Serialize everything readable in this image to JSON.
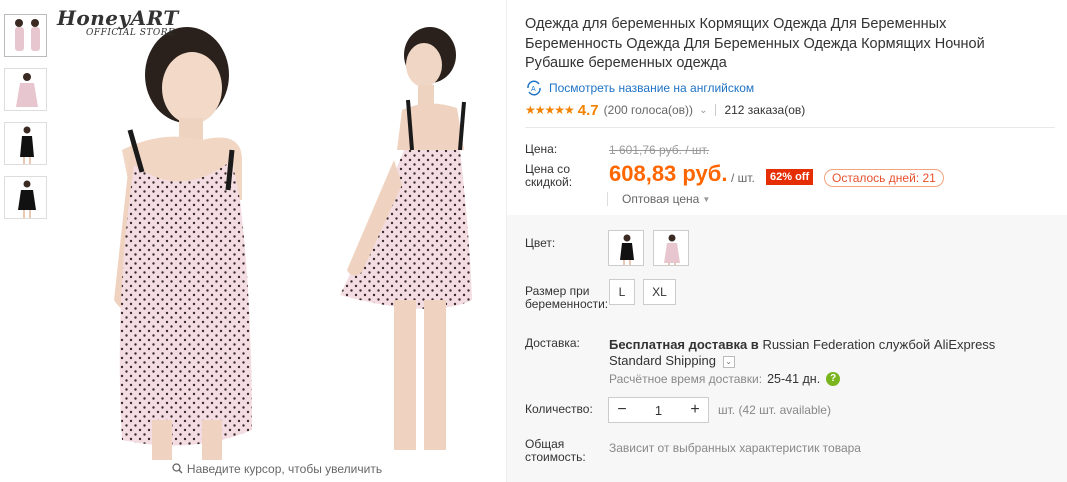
{
  "brand": {
    "name": "HoneyART",
    "subtitle": "OFFICIAL STORE"
  },
  "gallery": {
    "thumbnails": [
      "pink-dress-front",
      "pink-dress-back",
      "black-dress-front",
      "black-dress-back"
    ],
    "zoom_hint": "Наведите курсор, чтобы увеличить"
  },
  "product": {
    "title": "Одежда для беременных Кормящих Одежда Для Беременных Беременность Одежда Для Беременных Одежда Кормящих Ночной Рубашке беременных одежда",
    "translate_link": "Посмотреть название на английском",
    "rating": {
      "stars": "★★★★★",
      "value": "4.7",
      "votes": "(200 голоса(ов))",
      "orders": "212 заказа(ов)"
    }
  },
  "price": {
    "label": "Цена:",
    "old": "1 601,76 руб. / шт.",
    "discount_label": "Цена со скидкой:",
    "new": "608,83 руб.",
    "unit": "/ шт.",
    "discount_badge": "62% off",
    "days_left": "Осталось дней: 21",
    "wholesale": "Оптовая цена"
  },
  "options": {
    "color_label": "Цвет:",
    "colors": [
      "black",
      "pink"
    ],
    "size_label": "Размер при беременности:",
    "sizes": [
      "L",
      "XL"
    ]
  },
  "shipping": {
    "label": "Доставка:",
    "free_text": "Бесплатная доставка в",
    "destination": "Russian Federation службой AliExpress Standard Shipping",
    "est_label": "Расчётное время доставки:",
    "est_days": "25-41 дн."
  },
  "quantity": {
    "label": "Количество:",
    "value": "1",
    "minus": "−",
    "plus": "+",
    "available": "шт. (42 шт. available)"
  },
  "total": {
    "label": "Общая стоимость:",
    "note": "Зависит от выбранных характеристик товара"
  },
  "colors": {
    "price": "#ff6600",
    "link": "#2073c5",
    "star": "#f28200",
    "badge": "#e62e04"
  }
}
